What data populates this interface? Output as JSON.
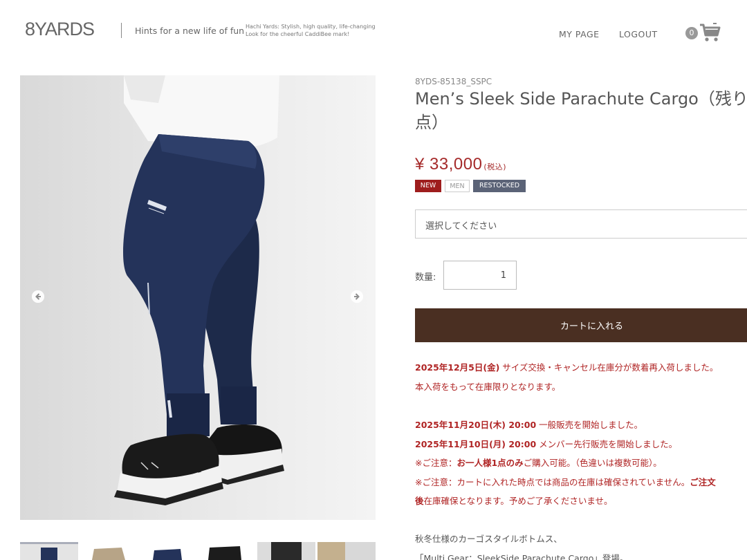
{
  "header": {
    "logo_text": "8YARDS",
    "tagline": "Hints for a new life of fun",
    "subtagline_1": "Hachi Yards: Stylish, high quality, life-changing",
    "subtagline_2": "Look for the cheerful CaddiBee mark!",
    "nav_mypage": "MY PAGE",
    "nav_logout": "LOGOUT",
    "cart_count": "0"
  },
  "product": {
    "sku": "8YDS-85138_SSPC",
    "title_line1": "Men’s Sleek Side Parachute Cargo（残り",
    "title_line2": "点）",
    "price": "¥ 33,000",
    "tax_label": "(税込)",
    "badges": {
      "new": "NEW",
      "men": "MEN",
      "restocked": "RESTOCKED"
    },
    "select_placeholder": "選択してください",
    "qty_label": "数量:",
    "qty_value": "1",
    "add_to_cart": "カートに入れる"
  },
  "notices": {
    "line1_bold": "2025年12月5日(金)",
    "line1_rest": " サイズ交換・キャンセル在庫分が数着再入荷しました。",
    "line2": "本入荷をもって在庫限りとなります。",
    "line3_bold": "2025年11月20日(木) 20:00",
    "line3_rest": " 一般販売を開始しました。",
    "line4_bold": "2025年11月10日(月) 20:00",
    "line4_rest": " メンバー先行販売を開始しました。",
    "line5_a": "※ご注意：",
    "line5_bold": "お一人様1点のみ",
    "line5_b": "ご購入可能。（色違いは複数可能）。",
    "line6_a": "※ご注意：カートに入れた時点では商品の在庫は確保されていません。",
    "line6_bold": "ご注文",
    "line7_bold": "後",
    "line7_rest": "在庫確保となります。予めご了承くださいませ。"
  },
  "description": {
    "line1": "秋冬仕様のカーゴスタイルボトムス、",
    "line2": "「Multi Gear：SleekSide Parachute Cargo」登場。"
  },
  "colors": {
    "accent_red": "#a52a2a",
    "button_brown": "#4a2f22",
    "badge_new": "#9e1d1d",
    "badge_restocked": "#5b6377"
  }
}
